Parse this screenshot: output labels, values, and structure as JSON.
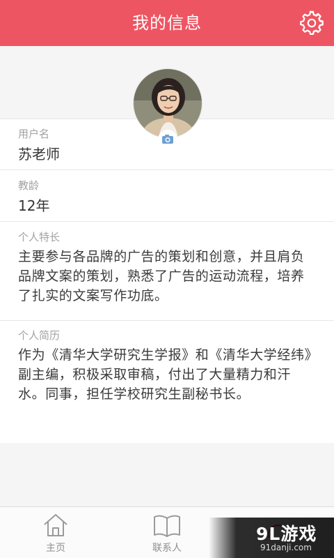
{
  "header": {
    "title": "我的信息",
    "settings_icon": "gear-icon"
  },
  "profile": {
    "avatar_icon": "avatar-photo",
    "camera_icon": "camera-icon"
  },
  "fields": {
    "username": {
      "label": "用户名",
      "value": "苏老师"
    },
    "teaching_years": {
      "label": "教龄",
      "value": "12年"
    },
    "specialty": {
      "label": "个人特长",
      "value": "主要参与各品牌的广告的策划和创意，并且肩负品牌文案的策划，熟悉了广告的运动流程，培养了扎实的文案写作功底。"
    },
    "resume": {
      "label": "个人简历",
      "value": "作为《清华大学研究生学报》和《清华大学经纬》副主编，积极采取审稿，付出了大量精力和汗水。同事，担任学校研究生副秘书长。"
    }
  },
  "tabbar": {
    "items": [
      {
        "label": "主页",
        "icon": "home-icon"
      },
      {
        "label": "联系人",
        "icon": "book-icon"
      },
      {
        "label": "",
        "icon": "profile-icon"
      }
    ]
  },
  "watermark": {
    "brand": "9L游戏",
    "url": "91danji.com"
  },
  "colors": {
    "accent": "#ee5562",
    "background": "#f5f5f5",
    "card": "#ffffff",
    "label": "#a2a2a2",
    "text": "#333333"
  }
}
